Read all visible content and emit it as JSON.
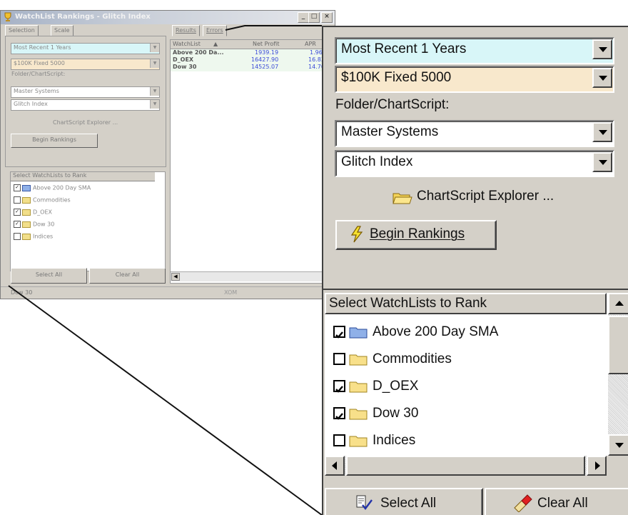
{
  "window": {
    "title": "WatchList Rankings - Glitch Index",
    "title_buttons": [
      "_",
      "□",
      "×"
    ]
  },
  "tabs_left": [
    "Selection",
    "Scale"
  ],
  "tabs_right": [
    "Results",
    "Errors"
  ],
  "selection": {
    "period": "Most Recent 1 Years",
    "sizing": "$100K Fixed 5000",
    "folder_label": "Folder/ChartScript:",
    "folder": "Master Systems",
    "chartscript": "Glitch Index",
    "explorer_label": "ChartScript Explorer ...",
    "begin_label": "Begin Rankings"
  },
  "watchlists": {
    "header": "Select WatchLists to Rank",
    "items": [
      {
        "label": "Above 200 Day SMA",
        "checked": true,
        "folder_color": "blue"
      },
      {
        "label": "Commodities",
        "checked": false,
        "folder_color": "yellow"
      },
      {
        "label": "D_OEX",
        "checked": true,
        "folder_color": "yellow"
      },
      {
        "label": "Dow 30",
        "checked": true,
        "folder_color": "yellow"
      },
      {
        "label": "Indices",
        "checked": false,
        "folder_color": "yellow"
      }
    ],
    "select_all_label": "Select All",
    "clear_all_label": "Clear All"
  },
  "results": {
    "columns": [
      "WatchList",
      "Net Profit",
      "APR"
    ],
    "rows": [
      {
        "watchlist": "Above 200 Da...",
        "net_profit": "1939.19",
        "apr": "1.96"
      },
      {
        "watchlist": "D_OEX",
        "net_profit": "16427.90",
        "apr": "16.83"
      },
      {
        "watchlist": "Dow 30",
        "net_profit": "14525.07",
        "apr": "14.70"
      }
    ]
  },
  "status": {
    "left": "Dow 30",
    "middle": "XOM"
  },
  "colors": {
    "period_bg": "#d8f6f8",
    "sizing_bg": "#f8e8cc",
    "results_value": "#3a4ad8"
  }
}
